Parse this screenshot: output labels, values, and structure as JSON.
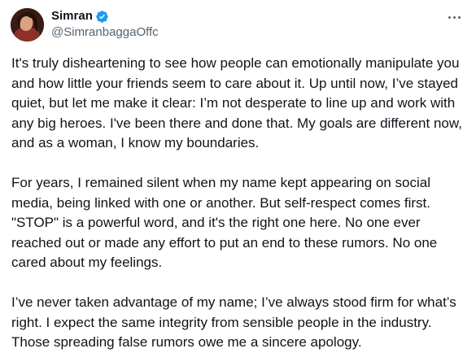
{
  "tweet": {
    "author": {
      "name": "Simran",
      "handle": "@SimranbaggaOffc",
      "verified": true,
      "verified_color": "#1d9bf0"
    },
    "more_icon": "more-horizontal-icon",
    "paragraphs": [
      "It's truly disheartening to see how people can emotionally manipulate you and how little your friends seem to care about it. Up until now, I’ve stayed quiet, but let me make it clear: I’m not desperate to line up and work with any big heroes. I've been there and done that. My goals are different now, and as a woman, I know my boundaries.",
      "For years, I remained silent when my name kept appearing on social media, being linked with one or another. But self-respect comes first. \"STOP\" is a powerful word, and it's the right one here. No one ever reached out or made any effort to put an end to these rumors. No one cared about my feelings.",
      "I’ve never taken advantage of my name; I’ve always stood firm for what’s right. I expect the same integrity from sensible people in the industry. Those spreading false rumors owe me a sincere apology."
    ]
  }
}
